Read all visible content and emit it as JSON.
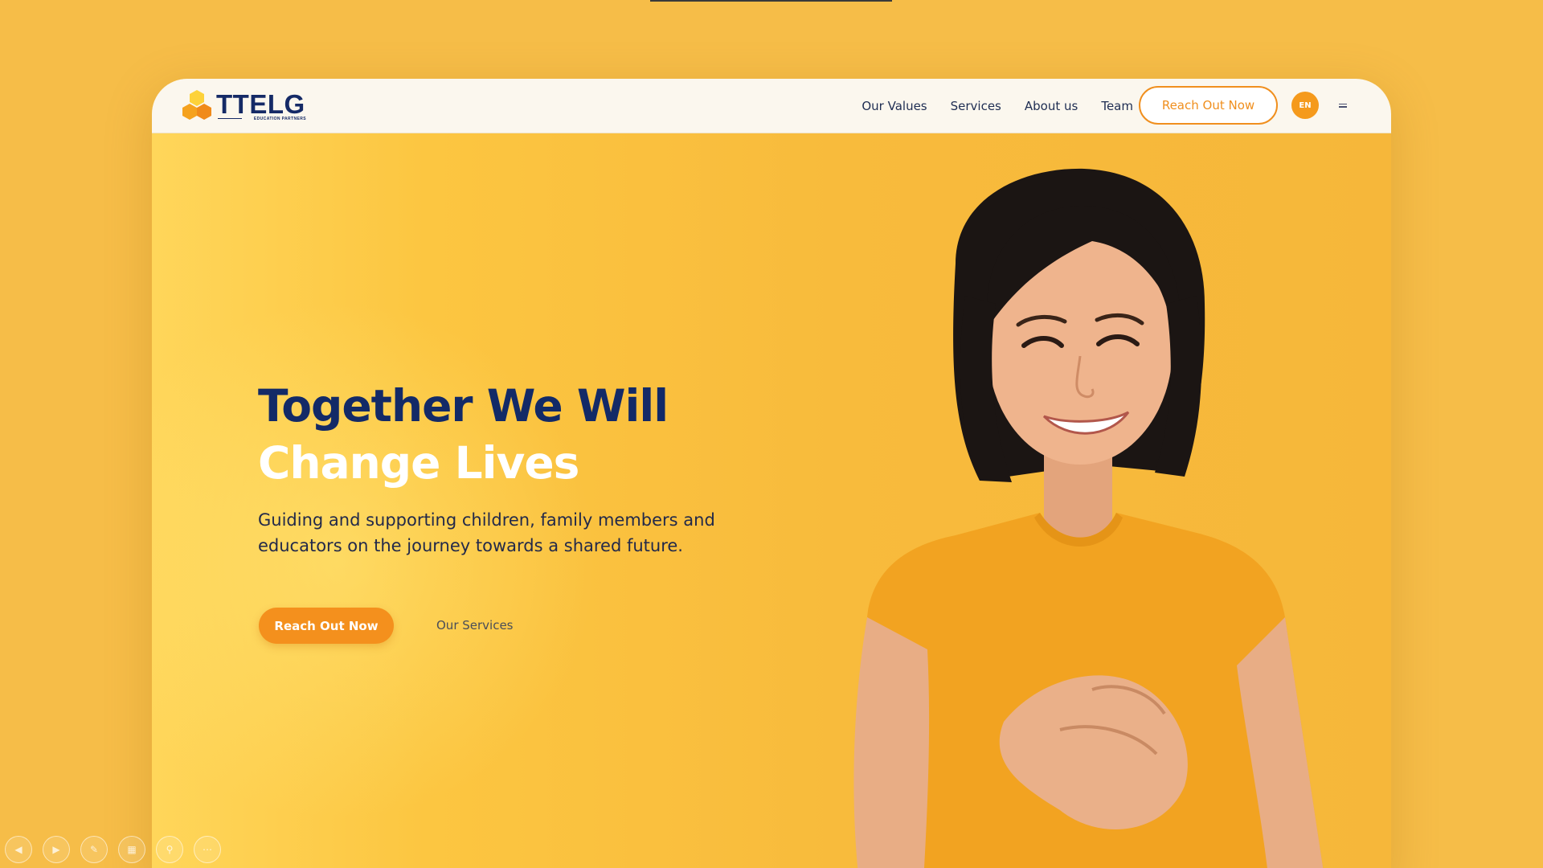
{
  "brand": {
    "name": "TTELG",
    "tagline": "EDUCATION PARTNERS",
    "colors": {
      "navy": "#132a67",
      "orange": "#f4901d",
      "yellow": "#f6bd48"
    }
  },
  "nav": {
    "links": [
      "Our Values",
      "Services",
      "About us",
      "Team"
    ],
    "cta_label": "Reach Out Now",
    "language": "EN",
    "menu_icon": "hamburger-icon"
  },
  "hero": {
    "title_line1": "Together We Will",
    "title_line2": "Change Lives",
    "subtitle": "Guiding and supporting children, family members and educators on the journey towards a shared future.",
    "primary_cta": "Reach Out Now",
    "secondary_link": "Our Services",
    "image": "smiling-woman-hands-on-heart"
  },
  "slideshow_toolbar": {
    "buttons": [
      "previous-icon",
      "next-icon",
      "pen-icon",
      "slides-icon",
      "zoom-icon",
      "more-icon"
    ]
  }
}
